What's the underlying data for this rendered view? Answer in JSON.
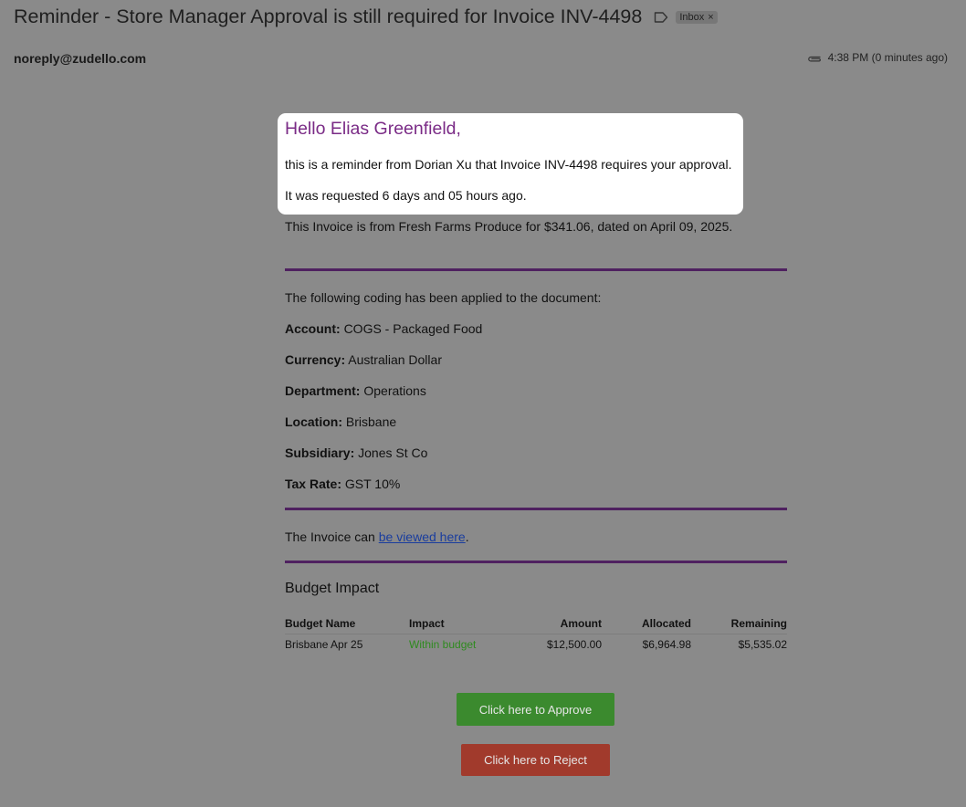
{
  "email": {
    "subject": "Reminder - Store Manager Approval is still required for Invoice INV-4498",
    "label_chip": "Inbox",
    "sender": "noreply@zudello.com",
    "time": "4:38 PM (0 minutes ago)"
  },
  "body": {
    "greeting": "Hello Elias Greenfield,",
    "reminder": "this is a reminder from Dorian Xu that Invoice INV-4498 requires your approval.",
    "requested": "It was requested 6 days and 05 hours ago.",
    "invoice_info": "This Invoice is from Fresh Farms Produce for $341.06, dated on April 09, 2025.",
    "coding_intro": "The following coding has been applied to the document:",
    "coding": [
      {
        "key": "Account:",
        "value": "COGS - Packaged Food"
      },
      {
        "key": "Currency:",
        "value": "Australian Dollar"
      },
      {
        "key": "Department:",
        "value": "Operations"
      },
      {
        "key": "Location:",
        "value": "Brisbane"
      },
      {
        "key": "Subsidiary:",
        "value": "Jones St Co"
      },
      {
        "key": "Tax Rate:",
        "value": "GST 10%"
      }
    ],
    "view_prefix": "The Invoice can ",
    "view_link": "be viewed here",
    "view_suffix": "."
  },
  "budget": {
    "title": "Budget Impact",
    "columns": [
      "Budget Name",
      "Impact",
      "Amount",
      "Allocated",
      "Remaining"
    ],
    "rows": [
      {
        "name": "Brisbane Apr 25",
        "impact": "Within budget",
        "amount": "$12,500.00",
        "allocated": "$6,964.98",
        "remaining": "$5,535.02"
      }
    ]
  },
  "actions": {
    "approve": "Click here to Approve",
    "reject": "Click here to Reject"
  },
  "colors": {
    "greeting": "#7a2b86",
    "rule": "#4f2160",
    "approve": "#3b8a2e",
    "reject": "#a13a2c",
    "within_budget": "#2f8a1f"
  },
  "icons": [
    "label-icon",
    "paperclip-icon",
    "close-icon"
  ]
}
